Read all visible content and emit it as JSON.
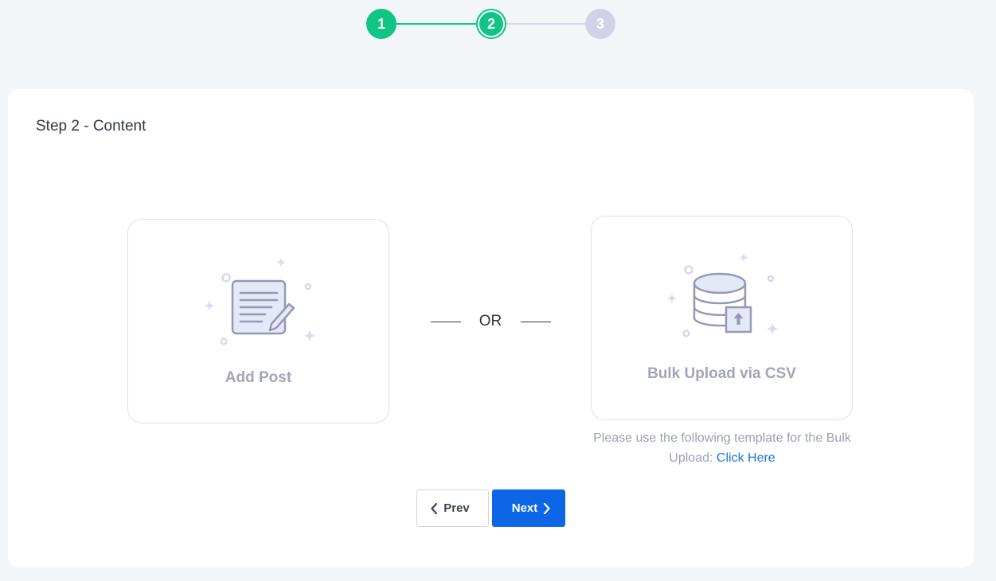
{
  "stepper": {
    "steps": [
      {
        "number": "1",
        "state": "done"
      },
      {
        "number": "2",
        "state": "active"
      },
      {
        "number": "3",
        "state": "pending"
      }
    ],
    "colors": {
      "done": "#10c484",
      "pending": "#d0d3e6"
    }
  },
  "card": {
    "title": "Step 2 - Content"
  },
  "options": {
    "add_post": {
      "label": "Add Post",
      "icon": "document-edit-icon"
    },
    "bulk_upload": {
      "label": "Bulk Upload via CSV",
      "icon": "database-upload-icon"
    },
    "separator": "OR"
  },
  "template_note": {
    "text": "Please use the following template for the Bulk Upload:",
    "link": "Click Here"
  },
  "buttons": {
    "prev": {
      "label": "Prev",
      "icon": "chevron-left-icon"
    },
    "next": {
      "label": "Next",
      "icon": "chevron-right-icon"
    }
  },
  "colors": {
    "accent": "#0d66e5",
    "link": "#1976e6",
    "success": "#10c484",
    "page_bg": "#f3f6f9"
  }
}
